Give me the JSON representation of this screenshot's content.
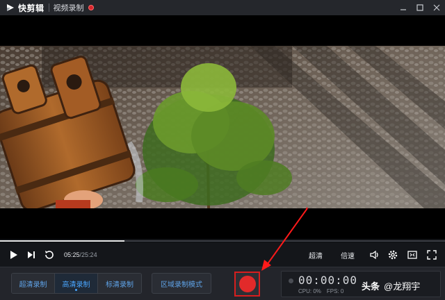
{
  "app": {
    "name": "快剪辑",
    "mode_title": "视频录制",
    "accent_color": "#4aa6ff",
    "record_color": "#e22a2a"
  },
  "window_controls": {
    "minimize_icon": "minimize-icon",
    "maximize_icon": "maximize-icon",
    "close_icon": "close-icon"
  },
  "player": {
    "current_time": "05:25",
    "separator": "/",
    "duration": "25:24",
    "progress_fraction": 0.28,
    "quality_label": "超清",
    "speed_label": "倍速"
  },
  "record_modes": {
    "items": [
      {
        "label": "超清录制",
        "active": false
      },
      {
        "label": "高清录制",
        "active": true
      },
      {
        "label": "标清录制",
        "active": false
      }
    ],
    "area_mode_label": "区域录制模式"
  },
  "recording": {
    "timer": "00:00:00",
    "cpu": "CPU: 0%",
    "fps": "FPS: 0",
    "record_icon": "record-icon"
  },
  "watermark": {
    "brand": "头条",
    "handle": "@龙翔宇"
  }
}
